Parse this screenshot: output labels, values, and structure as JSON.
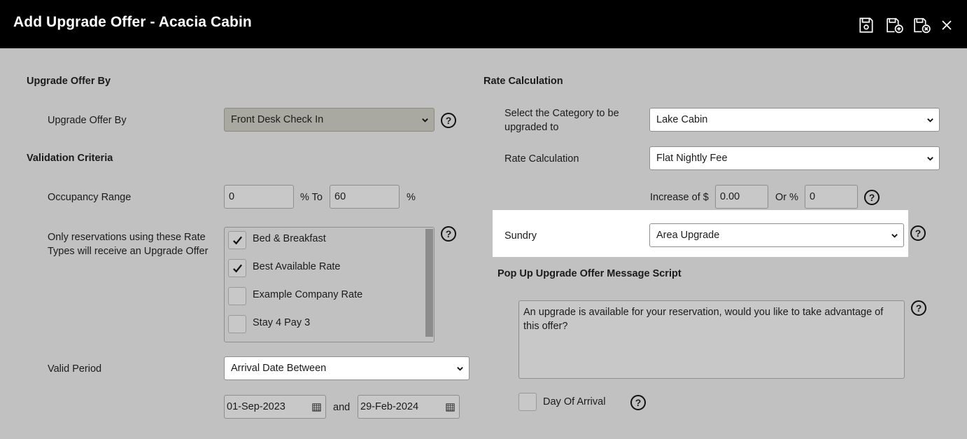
{
  "header": {
    "title": "Add Upgrade Offer - Acacia Cabin"
  },
  "left": {
    "upgrade_offer_by_section": "Upgrade Offer By",
    "upgrade_offer_by_label": "Upgrade Offer By",
    "upgrade_offer_by_value": "Front Desk Check In",
    "validation_section": "Validation Criteria",
    "occupancy_label": "Occupancy Range",
    "occupancy_from": "0",
    "occupancy_to_label": "% To",
    "occupancy_to": "60",
    "occupancy_pct": "%",
    "rate_types_label": "Only reservations using these Rate Types will receive an Upgrade Offer",
    "rate_types": [
      {
        "label": "Bed & Breakfast",
        "checked": true
      },
      {
        "label": "Best Available Rate",
        "checked": true
      },
      {
        "label": "Example Company Rate",
        "checked": false
      },
      {
        "label": "Stay 4 Pay 3",
        "checked": false
      }
    ],
    "valid_period_label": "Valid Period",
    "valid_period_value": "Arrival Date Between",
    "date_from": "01-Sep-2023",
    "date_and": "and",
    "date_to": "29-Feb-2024"
  },
  "right": {
    "rate_calc_section": "Rate Calculation",
    "category_label": "Select the Category to be upgraded to",
    "category_value": "Lake Cabin",
    "rate_calc_label": "Rate Calculation",
    "rate_calc_value": "Flat Nightly Fee",
    "increase_label": "Increase of $",
    "increase_value": "0.00",
    "or_pct_label": "Or %",
    "or_pct_value": "0",
    "sundry_label": "Sundry",
    "sundry_value": "Area Upgrade",
    "popup_section": "Pop Up Upgrade Offer Message Script",
    "popup_message": "An upgrade is available for your reservation, would you like to take advantage of this offer?",
    "day_of_arrival_label": "Day Of Arrival"
  },
  "help_glyph": "?",
  "colors": {
    "header_bg": "#000000",
    "page_bg": "#c1c1c1",
    "highlight_bg": "#ffffff"
  }
}
